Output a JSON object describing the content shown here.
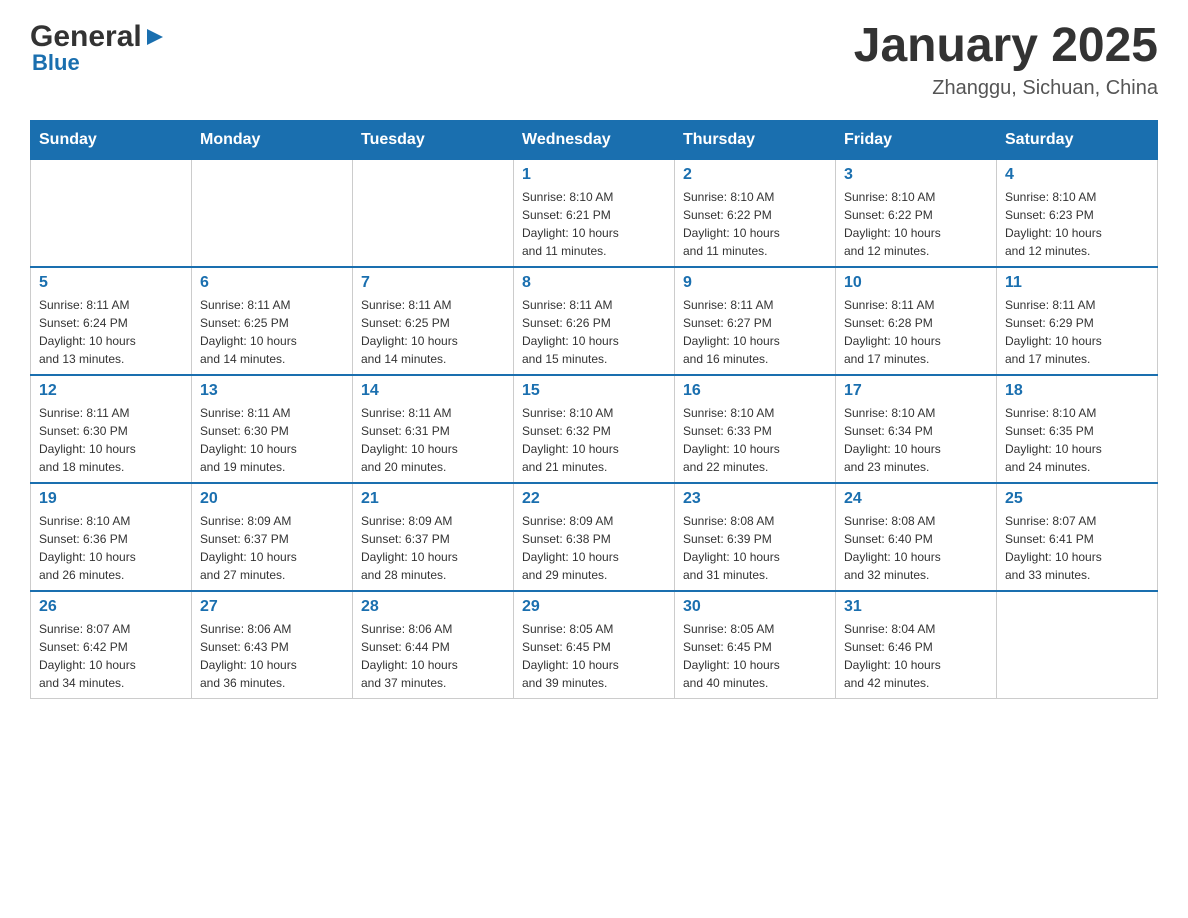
{
  "header": {
    "logo": {
      "general": "General",
      "blue": "Blue"
    },
    "title": "January 2025",
    "location": "Zhanggu, Sichuan, China"
  },
  "calendar": {
    "days_of_week": [
      "Sunday",
      "Monday",
      "Tuesday",
      "Wednesday",
      "Thursday",
      "Friday",
      "Saturday"
    ],
    "weeks": [
      [
        {
          "day": "",
          "info": ""
        },
        {
          "day": "",
          "info": ""
        },
        {
          "day": "",
          "info": ""
        },
        {
          "day": "1",
          "info": "Sunrise: 8:10 AM\nSunset: 6:21 PM\nDaylight: 10 hours\nand 11 minutes."
        },
        {
          "day": "2",
          "info": "Sunrise: 8:10 AM\nSunset: 6:22 PM\nDaylight: 10 hours\nand 11 minutes."
        },
        {
          "day": "3",
          "info": "Sunrise: 8:10 AM\nSunset: 6:22 PM\nDaylight: 10 hours\nand 12 minutes."
        },
        {
          "day": "4",
          "info": "Sunrise: 8:10 AM\nSunset: 6:23 PM\nDaylight: 10 hours\nand 12 minutes."
        }
      ],
      [
        {
          "day": "5",
          "info": "Sunrise: 8:11 AM\nSunset: 6:24 PM\nDaylight: 10 hours\nand 13 minutes."
        },
        {
          "day": "6",
          "info": "Sunrise: 8:11 AM\nSunset: 6:25 PM\nDaylight: 10 hours\nand 14 minutes."
        },
        {
          "day": "7",
          "info": "Sunrise: 8:11 AM\nSunset: 6:25 PM\nDaylight: 10 hours\nand 14 minutes."
        },
        {
          "day": "8",
          "info": "Sunrise: 8:11 AM\nSunset: 6:26 PM\nDaylight: 10 hours\nand 15 minutes."
        },
        {
          "day": "9",
          "info": "Sunrise: 8:11 AM\nSunset: 6:27 PM\nDaylight: 10 hours\nand 16 minutes."
        },
        {
          "day": "10",
          "info": "Sunrise: 8:11 AM\nSunset: 6:28 PM\nDaylight: 10 hours\nand 17 minutes."
        },
        {
          "day": "11",
          "info": "Sunrise: 8:11 AM\nSunset: 6:29 PM\nDaylight: 10 hours\nand 17 minutes."
        }
      ],
      [
        {
          "day": "12",
          "info": "Sunrise: 8:11 AM\nSunset: 6:30 PM\nDaylight: 10 hours\nand 18 minutes."
        },
        {
          "day": "13",
          "info": "Sunrise: 8:11 AM\nSunset: 6:30 PM\nDaylight: 10 hours\nand 19 minutes."
        },
        {
          "day": "14",
          "info": "Sunrise: 8:11 AM\nSunset: 6:31 PM\nDaylight: 10 hours\nand 20 minutes."
        },
        {
          "day": "15",
          "info": "Sunrise: 8:10 AM\nSunset: 6:32 PM\nDaylight: 10 hours\nand 21 minutes."
        },
        {
          "day": "16",
          "info": "Sunrise: 8:10 AM\nSunset: 6:33 PM\nDaylight: 10 hours\nand 22 minutes."
        },
        {
          "day": "17",
          "info": "Sunrise: 8:10 AM\nSunset: 6:34 PM\nDaylight: 10 hours\nand 23 minutes."
        },
        {
          "day": "18",
          "info": "Sunrise: 8:10 AM\nSunset: 6:35 PM\nDaylight: 10 hours\nand 24 minutes."
        }
      ],
      [
        {
          "day": "19",
          "info": "Sunrise: 8:10 AM\nSunset: 6:36 PM\nDaylight: 10 hours\nand 26 minutes."
        },
        {
          "day": "20",
          "info": "Sunrise: 8:09 AM\nSunset: 6:37 PM\nDaylight: 10 hours\nand 27 minutes."
        },
        {
          "day": "21",
          "info": "Sunrise: 8:09 AM\nSunset: 6:37 PM\nDaylight: 10 hours\nand 28 minutes."
        },
        {
          "day": "22",
          "info": "Sunrise: 8:09 AM\nSunset: 6:38 PM\nDaylight: 10 hours\nand 29 minutes."
        },
        {
          "day": "23",
          "info": "Sunrise: 8:08 AM\nSunset: 6:39 PM\nDaylight: 10 hours\nand 31 minutes."
        },
        {
          "day": "24",
          "info": "Sunrise: 8:08 AM\nSunset: 6:40 PM\nDaylight: 10 hours\nand 32 minutes."
        },
        {
          "day": "25",
          "info": "Sunrise: 8:07 AM\nSunset: 6:41 PM\nDaylight: 10 hours\nand 33 minutes."
        }
      ],
      [
        {
          "day": "26",
          "info": "Sunrise: 8:07 AM\nSunset: 6:42 PM\nDaylight: 10 hours\nand 34 minutes."
        },
        {
          "day": "27",
          "info": "Sunrise: 8:06 AM\nSunset: 6:43 PM\nDaylight: 10 hours\nand 36 minutes."
        },
        {
          "day": "28",
          "info": "Sunrise: 8:06 AM\nSunset: 6:44 PM\nDaylight: 10 hours\nand 37 minutes."
        },
        {
          "day": "29",
          "info": "Sunrise: 8:05 AM\nSunset: 6:45 PM\nDaylight: 10 hours\nand 39 minutes."
        },
        {
          "day": "30",
          "info": "Sunrise: 8:05 AM\nSunset: 6:45 PM\nDaylight: 10 hours\nand 40 minutes."
        },
        {
          "day": "31",
          "info": "Sunrise: 8:04 AM\nSunset: 6:46 PM\nDaylight: 10 hours\nand 42 minutes."
        },
        {
          "day": "",
          "info": ""
        }
      ]
    ]
  }
}
